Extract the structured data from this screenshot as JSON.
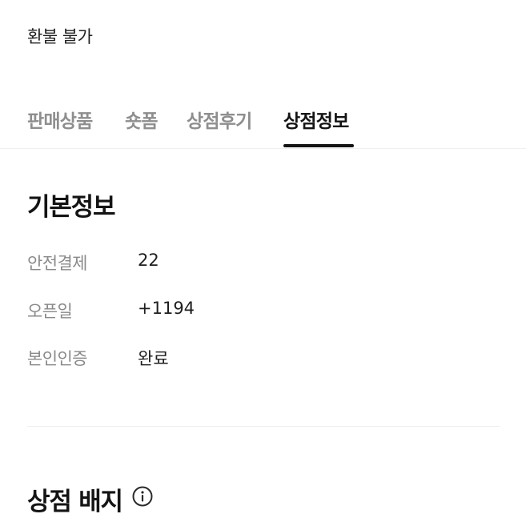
{
  "policy": {
    "refund_text": "환불 불가"
  },
  "tabs": [
    {
      "label": "판매상품",
      "active": false
    },
    {
      "label": "숏폼",
      "active": false
    },
    {
      "label": "상점후기",
      "active": false
    },
    {
      "label": "상점정보",
      "active": true
    }
  ],
  "basic_info": {
    "title": "기본정보",
    "rows": [
      {
        "label": "안전결제",
        "value": "22"
      },
      {
        "label": "오픈일",
        "value": "+1194"
      },
      {
        "label": "본인인증",
        "value": "완료"
      }
    ]
  },
  "badges": {
    "title": "상점 배지",
    "info_icon": "info-circle-icon"
  },
  "colors": {
    "active_tab": "#141414",
    "inactive_tab": "#8e8e8e",
    "label_gray": "#8a8a8a",
    "divider": "#eeeeee"
  }
}
